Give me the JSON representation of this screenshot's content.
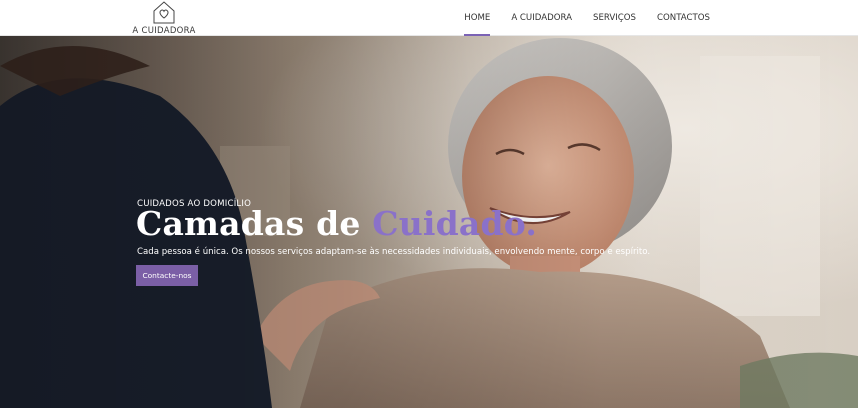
{
  "brand": {
    "name": "A CUIDADORA",
    "logo_icon": "house-heart-icon",
    "accent": "#7b5fa6"
  },
  "nav": {
    "items": [
      {
        "label": "HOME",
        "active": true
      },
      {
        "label": "A CUIDADORA",
        "active": false
      },
      {
        "label": "SERVIÇOS",
        "active": false
      },
      {
        "label": "CONTACTOS",
        "active": false
      }
    ]
  },
  "hero": {
    "eyebrow": "CUIDADOS AO DOMICÍLIO",
    "headline_part1": "Camadas de ",
    "headline_accent": "Cuidado.",
    "subtext": "Cada pessoa é única. Os nossos serviços adaptam-se às necessidades individuais, envolvendo mente, corpo e espírito.",
    "cta_label": "Contacte-nos",
    "accent_color": "#8a71c9"
  }
}
